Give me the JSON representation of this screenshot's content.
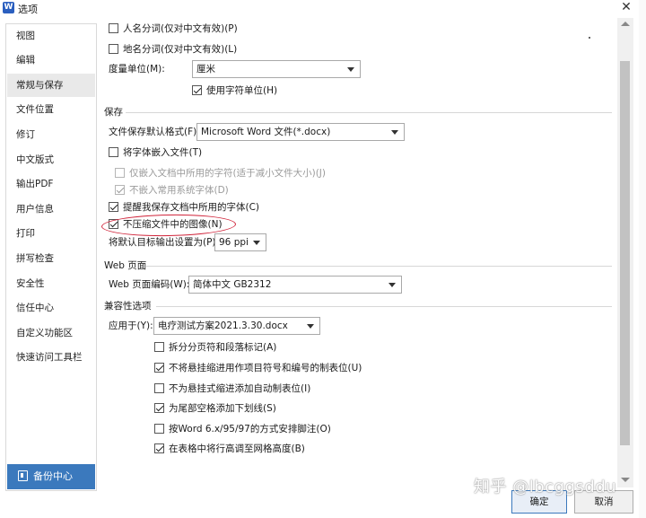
{
  "window": {
    "app_icon_letter": "W",
    "title": "选项",
    "close_glyph": "✕"
  },
  "sidebar": {
    "items": [
      {
        "label": "视图"
      },
      {
        "label": "编辑"
      },
      {
        "label": "常规与保存",
        "active": true
      },
      {
        "label": "文件位置"
      },
      {
        "label": "修订"
      },
      {
        "label": "中文版式"
      },
      {
        "label": "输出PDF"
      },
      {
        "label": "用户信息"
      },
      {
        "label": "打印"
      },
      {
        "label": "拼写检查"
      },
      {
        "label": "安全性"
      },
      {
        "label": "信任中心"
      },
      {
        "label": "自定义功能区"
      },
      {
        "label": "快速访问工具栏"
      }
    ],
    "backup_label": "备份中心"
  },
  "general": {
    "name_segment": {
      "label": "人名分词(仅对中文有效)(P)",
      "checked": false
    },
    "place_segment": {
      "label": "地名分词(仅对中文有效)(L)",
      "checked": false
    },
    "unit_label": "度量单位(M):",
    "unit_value": "厘米",
    "char_unit": {
      "label": "使用字符单位(H)",
      "checked": true
    }
  },
  "save": {
    "section_title": "保存",
    "format_label": "文件保存默认格式(F):",
    "format_value": "Microsoft Word 文件(*.docx)",
    "embed_fonts": {
      "label": "将字体嵌入文件(T)",
      "checked": false
    },
    "embed_used_only": {
      "label": "仅嵌入文档中所用的字符(适于减小文件大小)(J)",
      "checked": false,
      "disabled": true
    },
    "no_system_fonts": {
      "label": "不嵌入常用系统字体(D)",
      "checked": true,
      "disabled": true
    },
    "remind_fonts": {
      "label": "提醒我保存文档中所用的字体(C)",
      "checked": true
    },
    "no_compress": {
      "label": "不压缩文件中的图像(N)",
      "checked": true
    },
    "target_label": "将默认目标输出设置为(P):",
    "target_value": "96 ppi"
  },
  "web": {
    "section_title": "Web 页面",
    "encoding_label": "Web 页面编码(W):",
    "encoding_value": "简体中文 GB2312"
  },
  "compat": {
    "section_title": "兼容性选项",
    "apply_label": "应用于(Y):",
    "apply_value": "电疗测试方案2021.3.30.docx",
    "options": [
      {
        "label": "拆分分页符和段落标记(A)",
        "checked": false
      },
      {
        "label": "不将悬挂缩进用作项目符号和编号的制表位(U)",
        "checked": true
      },
      {
        "label": "不为悬挂式缩进添加自动制表位(I)",
        "checked": false
      },
      {
        "label": "为尾部空格添加下划线(S)",
        "checked": true
      },
      {
        "label": "按Word 6.x/95/97的方式安排脚注(O)",
        "checked": false
      },
      {
        "label": "在表格中将行高调至网格高度(B)",
        "checked": true
      }
    ]
  },
  "buttons": {
    "ok": "确定",
    "cancel": "取消"
  },
  "watermark": "知乎 @lbcggsddu",
  "colors": {
    "accent": "#3b79bd",
    "highlight_ellipse": "#d0243a"
  }
}
